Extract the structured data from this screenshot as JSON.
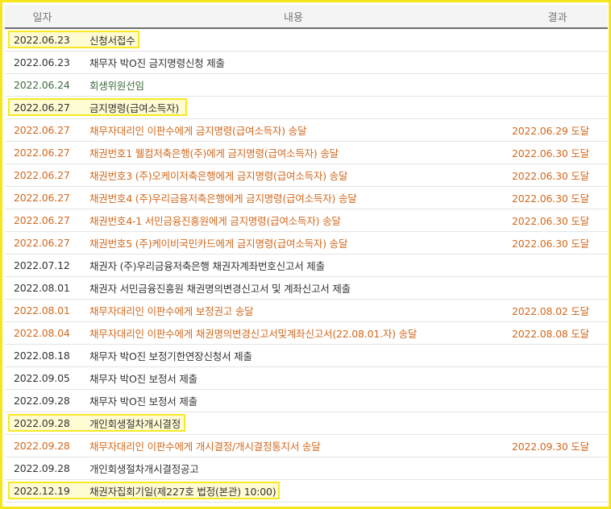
{
  "header": {
    "date": "일자",
    "content": "내용",
    "result": "결과"
  },
  "rows": [
    {
      "date": "2022.06.23",
      "content": "신청서접수",
      "result": "",
      "style": "hl"
    },
    {
      "date": "2022.06.23",
      "content": "채무자 박O진 금지명령신청 제출",
      "result": "",
      "style": "black"
    },
    {
      "date": "2022.06.24",
      "content": "회생위원선임",
      "result": "",
      "style": "green"
    },
    {
      "date": "2022.06.27",
      "content": "금지명령(급여소득자)",
      "result": "",
      "style": "hl"
    },
    {
      "date": "2022.06.27",
      "content": "채무자대리인 이판수에게 금지명령(급여소득자) 송달",
      "result": "2022.06.29 도달",
      "style": "orange"
    },
    {
      "date": "2022.06.27",
      "content": "채권번호1 웰컴저축은행(주)에게 금지명령(급여소득자) 송달",
      "result": "2022.06.30 도달",
      "style": "orange"
    },
    {
      "date": "2022.06.27",
      "content": "채권번호3 (주)오케이저축은행에게 금지명령(급여소득자) 송달",
      "result": "2022.06.30 도달",
      "style": "orange"
    },
    {
      "date": "2022.06.27",
      "content": "채권번호4 (주)우리금융저축은행에게 금지명령(급여소득자) 송달",
      "result": "2022.06.30 도달",
      "style": "orange"
    },
    {
      "date": "2022.06.27",
      "content": "채권번호4-1 서민금융진흥원에게 금지명령(급여소득자) 송달",
      "result": "2022.06.30 도달",
      "style": "orange"
    },
    {
      "date": "2022.06.27",
      "content": "채권번호5 (주)케이비국민카드에게 금지명령(급여소득자) 송달",
      "result": "2022.06.30 도달",
      "style": "orange"
    },
    {
      "date": "2022.07.12",
      "content": "채권자 (주)우리금융저축은행 채권자계좌번호신고서 제출",
      "result": "",
      "style": "black"
    },
    {
      "date": "2022.08.01",
      "content": "채권자 서민금융진흥원 채권명의변경신고서 및 계좌신고서 제출",
      "result": "",
      "style": "black"
    },
    {
      "date": "2022.08.01",
      "content": "채무자대리인 이판수에게 보정권고 송달",
      "result": "2022.08.02 도달",
      "style": "orange"
    },
    {
      "date": "2022.08.04",
      "content": "채무자대리인 이판수에게 채권명의변경신고서및계좌신고서(22.08.01.자) 송달",
      "result": "2022.08.08 도달",
      "style": "orange"
    },
    {
      "date": "2022.08.18",
      "content": "채무자 박O진 보정기한연장신청서 제출",
      "result": "",
      "style": "black"
    },
    {
      "date": "2022.09.05",
      "content": "채무자 박O진 보정서 제출",
      "result": "",
      "style": "black"
    },
    {
      "date": "2022.09.28",
      "content": "채무자 박O진 보정서 제출",
      "result": "",
      "style": "black"
    },
    {
      "date": "2022.09.28",
      "content": "개인회생절차개시결정",
      "result": "",
      "style": "hl"
    },
    {
      "date": "2022.09.28",
      "content": "채무자대리인 이판수에게 개시결정/개시결정통지서 송달",
      "result": "2022.09.30 도달",
      "style": "orange"
    },
    {
      "date": "2022.09.28",
      "content": "개인회생절차개시결정공고",
      "result": "",
      "style": "black"
    },
    {
      "date": "2022.12.19",
      "content": "채권자집회기일(제227호 법정(본관) 10:00)",
      "result": "",
      "style": "hl"
    }
  ]
}
